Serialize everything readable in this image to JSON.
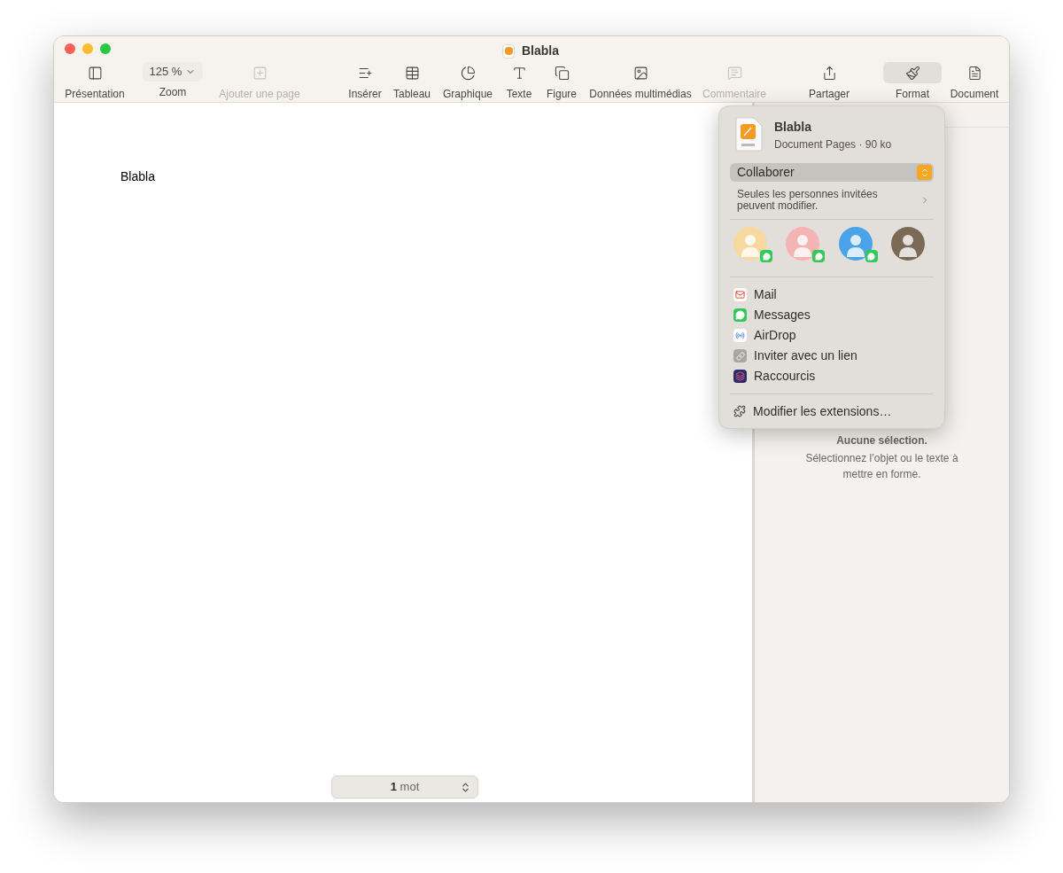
{
  "window": {
    "title": "Blabla"
  },
  "toolbar": {
    "items": [
      {
        "kind": "presentation",
        "label": "Présentation",
        "disabled": false,
        "selected": false
      },
      {
        "kind": "zoom",
        "label": "Zoom",
        "value": "125 %",
        "disabled": false,
        "selected": false
      },
      {
        "kind": "add_page",
        "label": "Ajouter une page",
        "disabled": true,
        "selected": false
      },
      {
        "kind": "insert",
        "label": "Insérer",
        "disabled": false,
        "selected": false
      },
      {
        "kind": "table",
        "label": "Tableau",
        "disabled": false,
        "selected": false
      },
      {
        "kind": "chart",
        "label": "Graphique",
        "disabled": false,
        "selected": false
      },
      {
        "kind": "text",
        "label": "Texte",
        "disabled": false,
        "selected": false
      },
      {
        "kind": "shape",
        "label": "Figure",
        "disabled": false,
        "selected": false
      },
      {
        "kind": "media",
        "label": "Données multimédias",
        "disabled": false,
        "selected": false
      },
      {
        "kind": "comment",
        "label": "Commentaire",
        "disabled": true,
        "selected": false
      },
      {
        "kind": "share",
        "label": "Partager",
        "disabled": false,
        "selected": false
      },
      {
        "kind": "format",
        "label": "Format",
        "disabled": false,
        "selected": true
      },
      {
        "kind": "document",
        "label": "Document",
        "disabled": false,
        "selected": false
      }
    ]
  },
  "document": {
    "text": "Blabla"
  },
  "word_count": {
    "count": "1",
    "unit": "mot"
  },
  "inspector": {
    "title": "Aucune sélection.",
    "message": "Sélectionnez l’objet ou le texte à mettre en forme."
  },
  "share_popover": {
    "file_name": "Blabla",
    "file_info": "Document Pages · 90 ko",
    "mode": "Collaborer",
    "access": "Seules les personnes invitées peuvent modifier.",
    "contacts": [
      {
        "color": "#f7d9a0",
        "messages": true
      },
      {
        "color": "#f4b4b4",
        "messages": true
      },
      {
        "color": "#4aa3e8",
        "messages": true
      },
      {
        "color": "#7a6a55",
        "messages": false
      }
    ],
    "apps": [
      {
        "kind": "mail",
        "label": "Mail"
      },
      {
        "kind": "messages",
        "label": "Messages"
      },
      {
        "kind": "airdrop",
        "label": "AirDrop"
      },
      {
        "kind": "link",
        "label": "Inviter avec un lien"
      },
      {
        "kind": "shortcuts",
        "label": "Raccourcis"
      }
    ],
    "footer": "Modifier les extensions…"
  }
}
